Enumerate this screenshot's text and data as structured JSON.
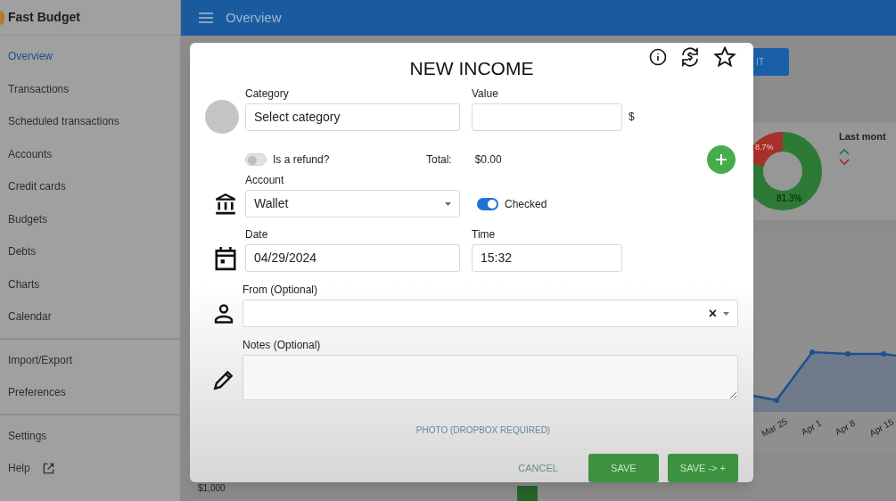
{
  "app": {
    "name": "Fast Budget"
  },
  "header": {
    "title": "Overview"
  },
  "sidebar": {
    "groups": [
      [
        {
          "label": "Overview",
          "selected": true,
          "kind": "plain"
        },
        {
          "label": "Transactions",
          "selected": false,
          "kind": "plain"
        },
        {
          "label": "Scheduled transactions",
          "selected": false,
          "kind": "plain"
        },
        {
          "label": "Accounts",
          "selected": false,
          "kind": "plain"
        },
        {
          "label": "Credit cards",
          "selected": false,
          "kind": "plain"
        },
        {
          "label": "Budgets",
          "selected": false,
          "kind": "plain"
        },
        {
          "label": "Debts",
          "selected": false,
          "kind": "plain"
        },
        {
          "label": "Charts",
          "selected": false,
          "kind": "plain"
        },
        {
          "label": "Calendar",
          "selected": false,
          "kind": "plain"
        }
      ],
      [
        {
          "label": "Import/Export",
          "selected": false,
          "kind": "plain"
        },
        {
          "label": "Preferences",
          "selected": false,
          "kind": "plain"
        }
      ],
      [
        {
          "label": "Settings",
          "selected": false,
          "kind": "plain"
        },
        {
          "label": "Help",
          "selected": false,
          "kind": "external"
        }
      ]
    ]
  },
  "background": {
    "button_fragment": "IT",
    "donut_labels": [
      "8.7%",
      "81.3%"
    ],
    "last_month_title": "Last mont",
    "line_chart_dates": [
      "Mar 25",
      "Apr 1",
      "Apr 8",
      "Apr 15"
    ],
    "axis_value": "$1,000"
  },
  "dialog": {
    "title": "NEW INCOME",
    "category": {
      "label": "Category",
      "placeholder": "Select category"
    },
    "value": {
      "label": "Value",
      "currency": "$"
    },
    "refund": {
      "label": "Is a refund?",
      "on": false
    },
    "total": {
      "label": "Total:",
      "value": "$0.00"
    },
    "account": {
      "label": "Account",
      "value": "Wallet"
    },
    "checked": {
      "label": "Checked",
      "on": true
    },
    "date": {
      "label": "Date",
      "value": "04/29/2024"
    },
    "time": {
      "label": "Time",
      "value": "15:32"
    },
    "from": {
      "label": "From (Optional)",
      "clear": "×"
    },
    "notes": {
      "label": "Notes (Optional)"
    },
    "photo_link": "PHOTO (DROPBOX REQUIRED)",
    "buttons": [
      {
        "label": "CANCEL",
        "kind": "text"
      },
      {
        "label": "SAVE",
        "kind": "filled"
      },
      {
        "label": "SAVE -> +",
        "kind": "filled"
      }
    ]
  }
}
